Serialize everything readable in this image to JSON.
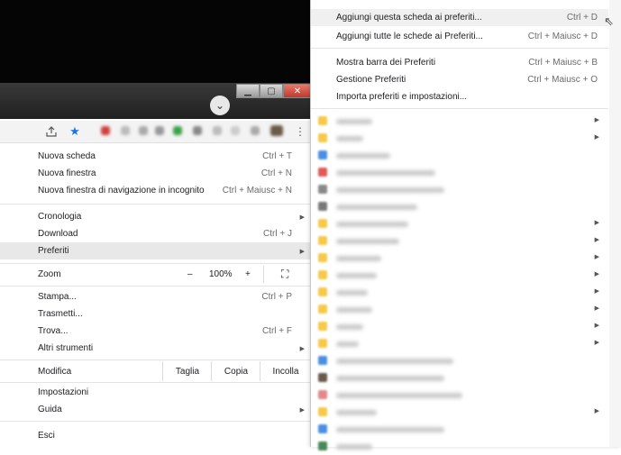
{
  "window": {
    "controls": {
      "minimize": "▁",
      "maximize": "▢",
      "close": "✕"
    },
    "chevron": "⌄"
  },
  "toolbar": {
    "share_icon": "share-icon",
    "star_icon": "star-icon",
    "more_icon": "more-vert-icon",
    "colors": {
      "star": "#1a73e8"
    }
  },
  "menu": {
    "items": [
      {
        "label": "Nuova scheda",
        "shortcut": "Ctrl + T"
      },
      {
        "label": "Nuova finestra",
        "shortcut": "Ctrl + N"
      },
      {
        "label": "Nuova finestra di navigazione in incognito",
        "shortcut": "Ctrl + Maiusc + N"
      },
      {
        "label": "Cronologia",
        "shortcut": ""
      },
      {
        "label": "Download",
        "shortcut": "Ctrl + J"
      },
      {
        "label": "Preferiti",
        "shortcut": ""
      },
      {
        "label": "Zoom",
        "shortcut": ""
      },
      {
        "label": "Stampa...",
        "shortcut": "Ctrl + P"
      },
      {
        "label": "Trasmetti...",
        "shortcut": ""
      },
      {
        "label": "Trova...",
        "shortcut": "Ctrl + F"
      },
      {
        "label": "Altri strumenti",
        "shortcut": ""
      },
      {
        "label": "Modifica",
        "shortcut": ""
      },
      {
        "label": "Impostazioni",
        "shortcut": ""
      },
      {
        "label": "Guida",
        "shortcut": ""
      },
      {
        "label": "Esci",
        "shortcut": ""
      }
    ],
    "zoom": {
      "minus": "–",
      "value": "100%",
      "plus": "+",
      "fullscreen": "⛶"
    },
    "edit": {
      "cut": "Taglia",
      "copy": "Copia",
      "paste": "Incolla"
    }
  },
  "bookmarks_submenu": {
    "actions": [
      {
        "label": "Aggiungi questa scheda ai preferiti...",
        "shortcut": "Ctrl + D"
      },
      {
        "label": "Aggiungi tutte le schede ai Preferiti...",
        "shortcut": "Ctrl + Maiusc + D"
      },
      {
        "label": "Mostra barra dei Preferiti",
        "shortcut": "Ctrl + Maiusc + B"
      },
      {
        "label": "Gestione Preferiti",
        "shortcut": "Ctrl + Maiusc + O"
      },
      {
        "label": "Importa preferiti e impostazioni...",
        "shortcut": ""
      }
    ],
    "blurred_items": [
      {
        "color": "#f7c948",
        "arrow": true
      },
      {
        "color": "#f7c948",
        "arrow": true
      },
      {
        "color": "#4a90e2",
        "arrow": false
      },
      {
        "color": "#e05a5a",
        "arrow": false
      },
      {
        "color": "#8a8a8a",
        "arrow": false
      },
      {
        "color": "#7a7a7a",
        "arrow": false
      },
      {
        "color": "#f7c948",
        "arrow": true
      },
      {
        "color": "#f7c948",
        "arrow": true
      },
      {
        "color": "#f7c948",
        "arrow": true
      },
      {
        "color": "#f7c948",
        "arrow": true
      },
      {
        "color": "#f7c948",
        "arrow": true
      },
      {
        "color": "#f7c948",
        "arrow": true
      },
      {
        "color": "#f7c948",
        "arrow": true
      },
      {
        "color": "#f7c948",
        "arrow": true
      },
      {
        "color": "#4a90e2",
        "arrow": false
      },
      {
        "color": "#6b5a4a",
        "arrow": false
      },
      {
        "color": "#e08a8a",
        "arrow": false
      },
      {
        "color": "#f7c948",
        "arrow": true
      },
      {
        "color": "#4a90e2",
        "arrow": false
      },
      {
        "color": "#4a8a5a",
        "arrow": false
      }
    ]
  }
}
